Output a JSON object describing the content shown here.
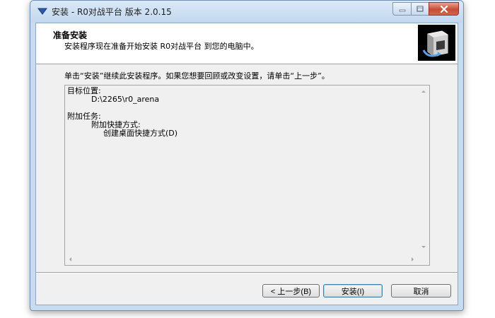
{
  "window": {
    "title": "安装 - R0对战平台 版本 2.0.15"
  },
  "header": {
    "title": "准备安装",
    "subtitle": "安装程序现在准备开始安装 R0对战平台 到您的电脑中。"
  },
  "instruction": "单击“安装”继续此安装程序。如果您想要回顾或改变设置，请单击“上一步”。",
  "memo": {
    "dest_heading": "目标位置:",
    "dest_path": "D:\\2265\\r0_arena",
    "tasks_heading": "附加任务:",
    "tasks_group": "附加快捷方式:",
    "tasks_item": "创建桌面快捷方式(D)"
  },
  "buttons": {
    "back": "< 上一步(B)",
    "install": "安装(I)",
    "cancel": "取消"
  }
}
